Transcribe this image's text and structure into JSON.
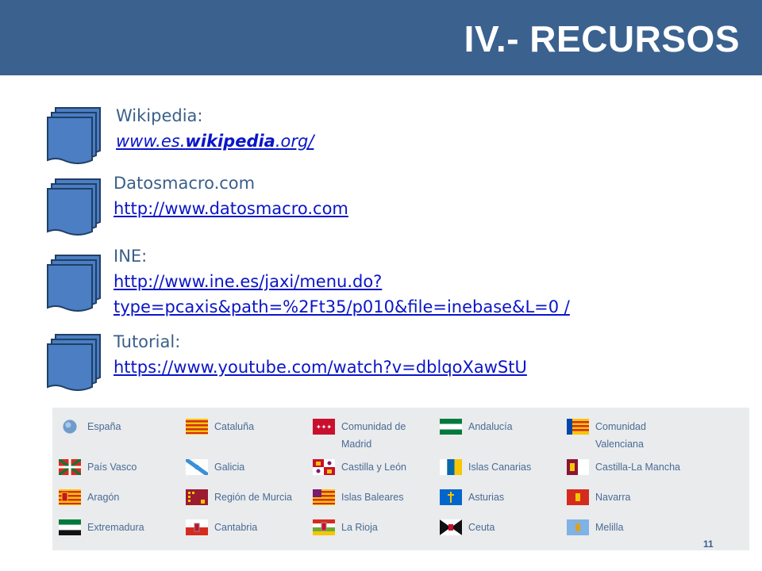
{
  "header": {
    "title": "IV.- RECURSOS"
  },
  "resources": [
    {
      "label": "Wikipedia:",
      "link_pre": "www.es.",
      "link_bold": "wikipedia",
      "link_post": ".org/"
    },
    {
      "label": "Datosmacro.com",
      "link": "http://www.datosmacro.com"
    },
    {
      "label": "INE:",
      "link": "http://www.ine.es/jaxi/menu.do?type=pcaxis&path=%2Ft35/p010&file=inebase&L=0 /"
    },
    {
      "label": "Tutorial:",
      "link": "https://www.youtube.com/watch?v=dblqoXawStU"
    }
  ],
  "regions": [
    "España",
    "Cataluña",
    "Comunidad de Madrid",
    "Andalucía",
    "Comunidad Valenciana",
    "País Vasco",
    "Galicia",
    "Castilla y León",
    "Islas Canarias",
    "Castilla-La Mancha",
    "Aragón",
    "Región de Murcia",
    "Islas Baleares",
    "Asturias",
    "Navarra",
    "Extremadura",
    "Cantabria",
    "La Rioja",
    "Ceuta",
    "Melilla"
  ],
  "page_number": "11"
}
